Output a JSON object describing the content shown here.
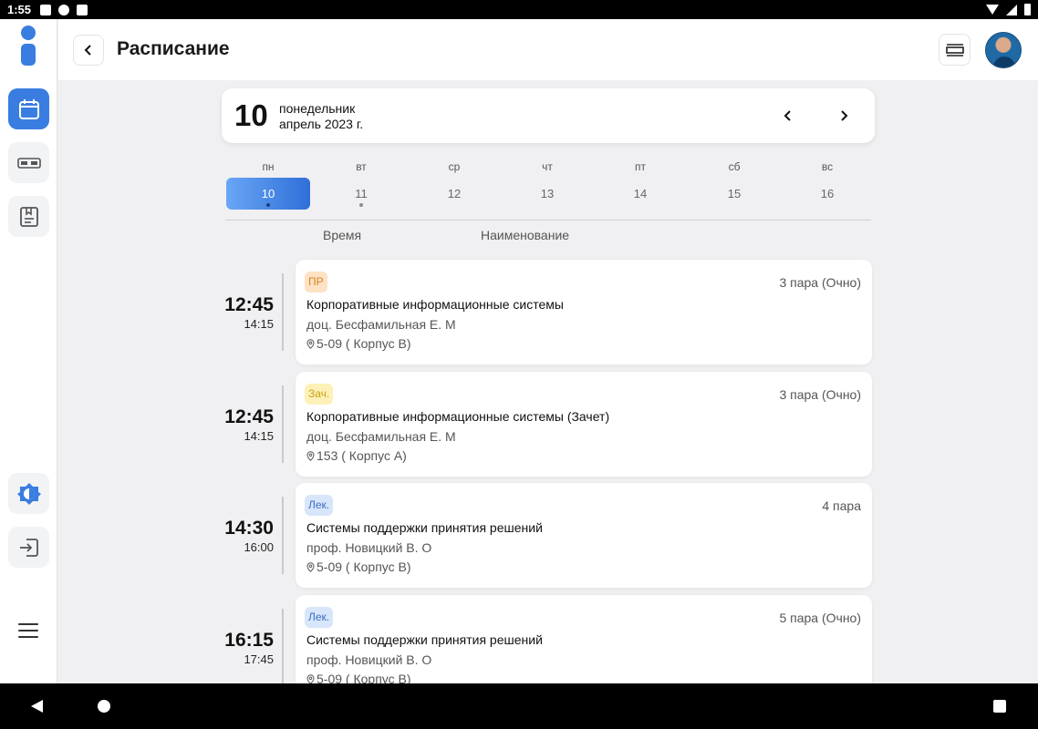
{
  "status_bar": {
    "time": "1:55"
  },
  "header": {
    "title": "Расписание"
  },
  "date_card": {
    "day_number": "10",
    "weekday": "понедельник",
    "month_year": "апрель 2023 г."
  },
  "week": {
    "days": [
      {
        "abbr": "пн",
        "num": "10"
      },
      {
        "abbr": "вт",
        "num": "11"
      },
      {
        "abbr": "ср",
        "num": "12"
      },
      {
        "abbr": "чт",
        "num": "13"
      },
      {
        "abbr": "пт",
        "num": "14"
      },
      {
        "abbr": "сб",
        "num": "15"
      },
      {
        "abbr": "вс",
        "num": "16"
      }
    ],
    "selected": "10"
  },
  "columns": {
    "time": "Время",
    "name": "Наименование"
  },
  "lessons": [
    {
      "start": "12:45",
      "end": "14:15",
      "badge": "ПР",
      "badge_bg": "#fde2c4",
      "badge_fg": "#d9822b",
      "meta": "3 пара (Очно)",
      "title": "Корпоративные информационные системы",
      "teacher": "доц. Бесфамильная Е. М",
      "room": "5-09 ( Корпус В)"
    },
    {
      "start": "12:45",
      "end": "14:15",
      "badge": "Зач.",
      "badge_bg": "#fdf1b8",
      "badge_fg": "#c9a114",
      "meta": "3 пара (Очно)",
      "title": "Корпоративные информационные системы (Зачет)",
      "teacher": "доц. Бесфамильная Е. М",
      "room": "153 ( Корпус А)"
    },
    {
      "start": "14:30",
      "end": "16:00",
      "badge": "Лек.",
      "badge_bg": "#d8e6fb",
      "badge_fg": "#3a6fc0",
      "meta": "4 пара",
      "title": "Системы поддержки принятия решений",
      "teacher": "проф. Новицкий В. О",
      "room": "5-09 ( Корпус В)"
    },
    {
      "start": "16:15",
      "end": "17:45",
      "badge": "Лек.",
      "badge_bg": "#d8e6fb",
      "badge_fg": "#3a6fc0",
      "meta": "5 пара (Очно)",
      "title": "Системы поддержки принятия решений",
      "teacher": "проф. Новицкий В. О",
      "room": "5-09 ( Корпус В)"
    }
  ],
  "colors": {
    "accent": "#3a7de0"
  },
  "icons": {
    "rail": [
      "calendar-icon",
      "ticket-icon",
      "bookmark-journal-icon",
      "theme-toggle-icon",
      "logout-icon",
      "menu-icon"
    ],
    "header": [
      "back-chevron-icon",
      "view-toggle-icon"
    ]
  }
}
